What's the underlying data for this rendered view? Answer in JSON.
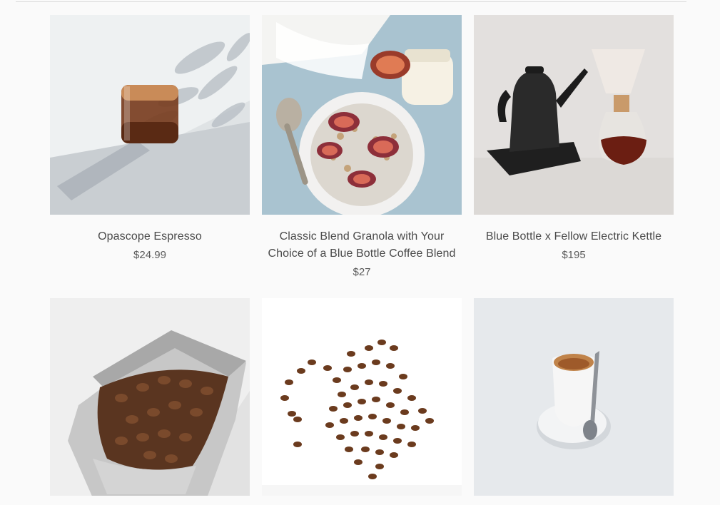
{
  "products": [
    {
      "title": "Opascope Espresso",
      "price": "$24.99",
      "image": "espresso-glass-photo"
    },
    {
      "title": "Classic Blend Granola with Your Choice of a Blue Bottle Coffee Blend",
      "price": "$27",
      "image": "granola-bowl-photo"
    },
    {
      "title": "Blue Bottle x Fellow Electric Kettle",
      "price": "$195",
      "image": "kettle-chemex-photo"
    },
    {
      "title": "",
      "price": "",
      "image": "coffee-bag-photo"
    },
    {
      "title": "",
      "price": "",
      "image": "coffee-beans-photo"
    },
    {
      "title": "",
      "price": "",
      "image": "espresso-cup-photo"
    }
  ]
}
